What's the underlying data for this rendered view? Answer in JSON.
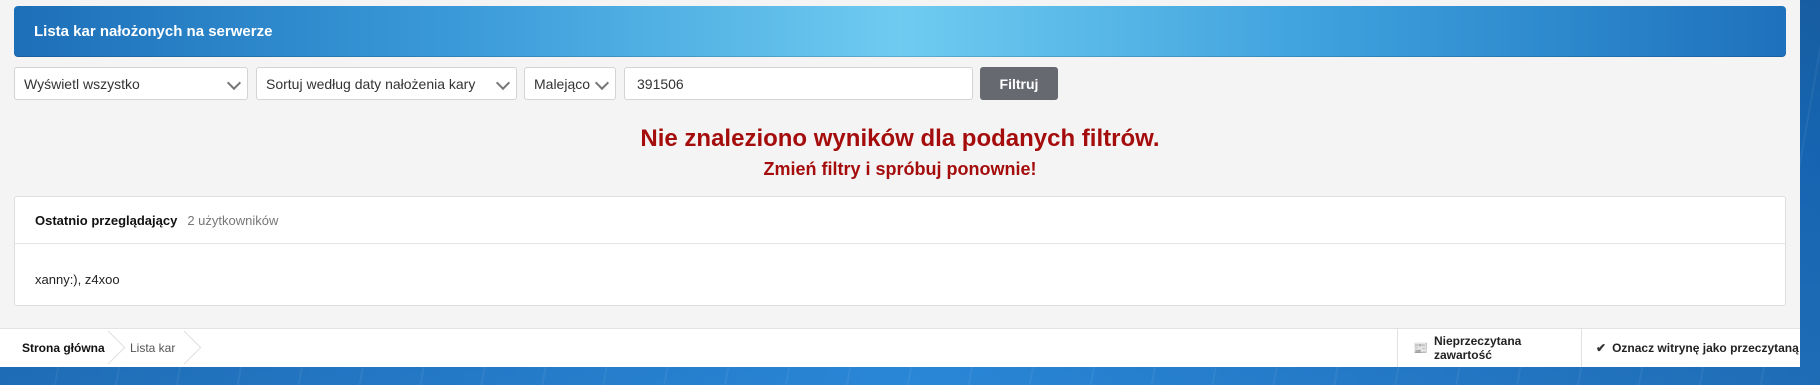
{
  "header": {
    "title": "Lista kar nałożonych na serwerze"
  },
  "filters": {
    "show": "Wyświetl wszystko",
    "sort": "Sortuj według daty nałożenia kary",
    "order": "Malejąco",
    "search_value": "391506",
    "filter_button": "Filtruj"
  },
  "result": {
    "message": "Nie znaleziono wyników dla podanych filtrów.",
    "hint": "Zmień filtry i spróbuj ponownie!"
  },
  "recent_viewers": {
    "title": "Ostatnio przeglądający",
    "count": "2 użytkowników",
    "users": "xanny:), z4xoo"
  },
  "breadcrumb": {
    "home": "Strona główna",
    "current": "Lista kar"
  },
  "footer_actions": {
    "unread": "Nieprzeczytana zawartość",
    "mark_read": "Oznacz witrynę jako przeczytaną"
  },
  "colors": {
    "error_text": "#a50d0d",
    "filter_button": "#666a70",
    "header_start": "#1d6fb8",
    "header_mid": "#6fcbf0"
  },
  "icons": {
    "unread": "newspaper-icon",
    "mark_read": "check-icon"
  }
}
